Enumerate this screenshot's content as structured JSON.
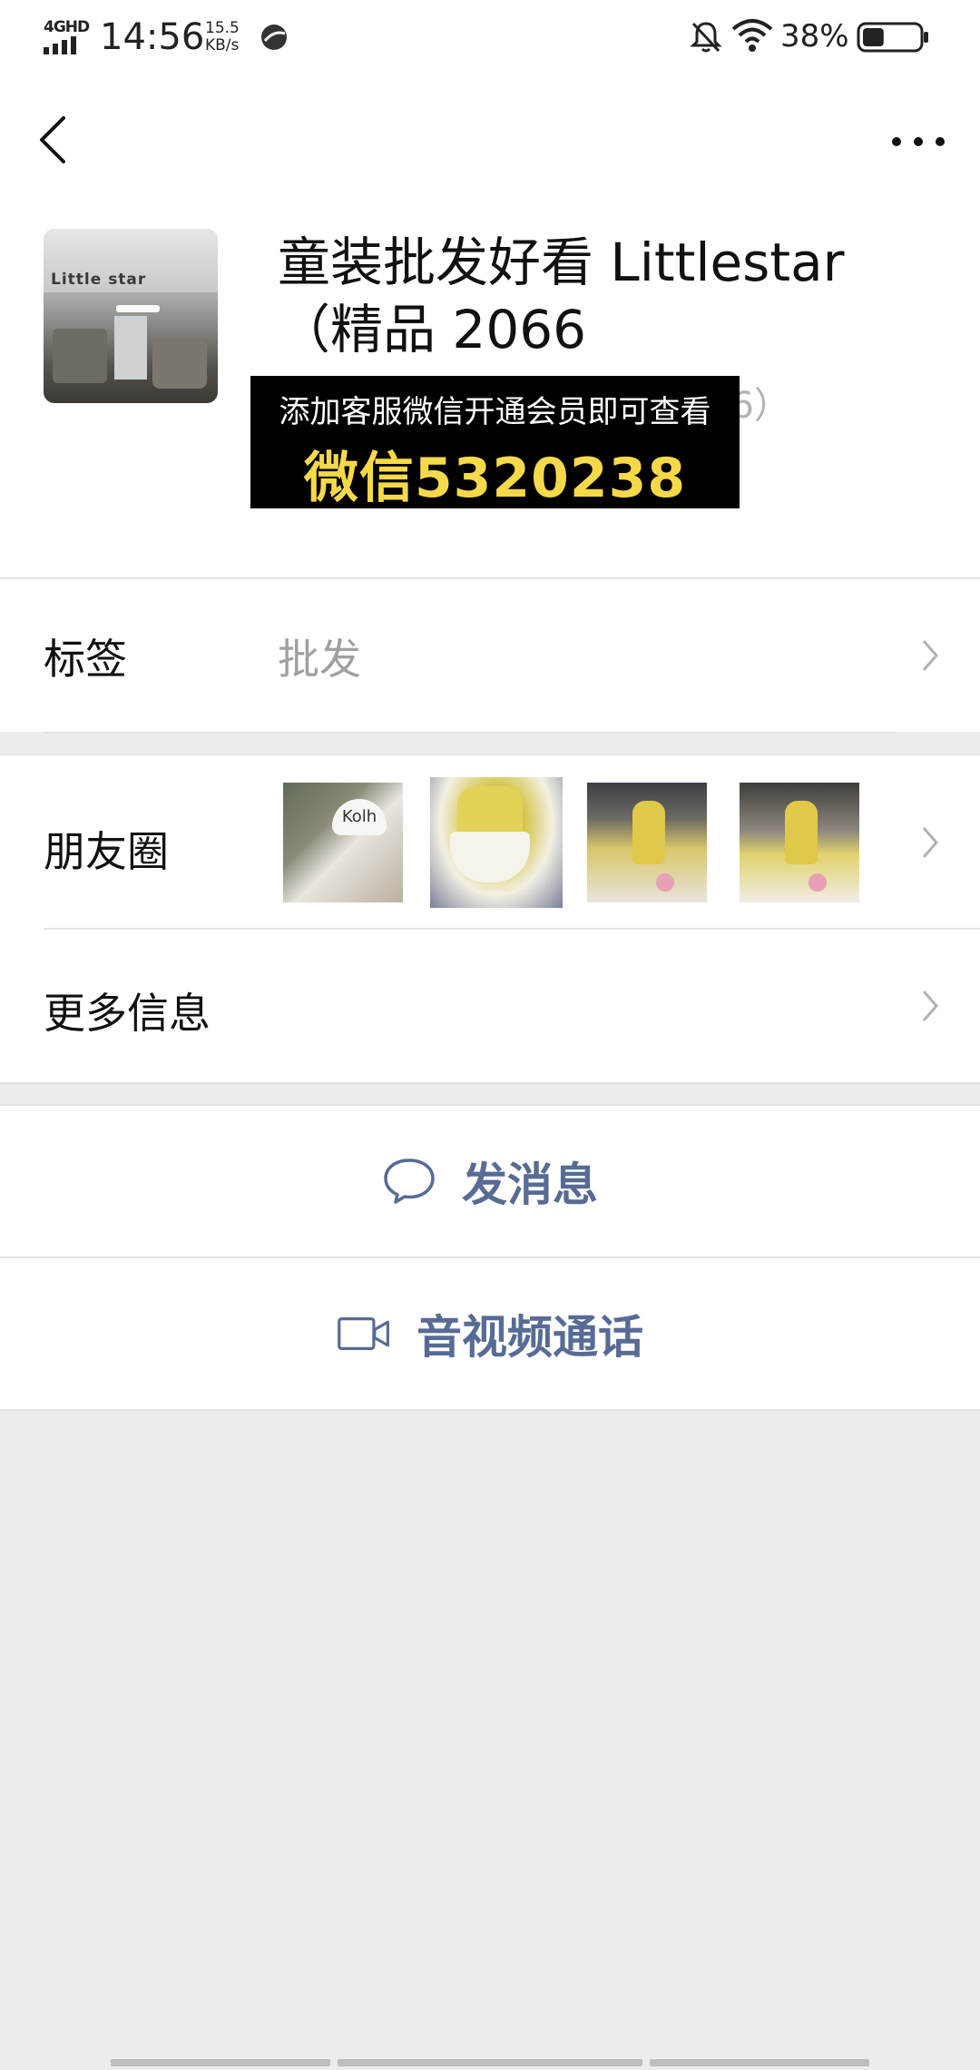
{
  "status_bar": {
    "network": "4GHD",
    "time": "14:56",
    "speed_value": "15.5",
    "speed_unit": "KB/s",
    "battery_percent": "38%",
    "battery_level": 0.38
  },
  "header": {
    "back_icon": "chevron-left-icon",
    "more_icon": "more-dots-icon"
  },
  "profile": {
    "avatar_sign_text": "Little star",
    "name": "童装批发好看 Littlestar（精品 2066",
    "id_fragment": "36）"
  },
  "promo": {
    "line1": "添加客服微信开通会员即可查看",
    "line2": "微信5320238",
    "text_color": "#f5d94a"
  },
  "rows": {
    "tags": {
      "label": "标签",
      "value": "批发"
    },
    "moments": {
      "label": "朋友圈",
      "thumb_text": "Kolh"
    },
    "more_info": {
      "label": "更多信息"
    }
  },
  "actions": {
    "message": {
      "label": "发消息",
      "icon": "chat-bubble-icon"
    },
    "call": {
      "label": "音视频通话",
      "icon": "video-camera-icon"
    }
  },
  "colors": {
    "link_blue": "#576b95",
    "background": "#ededed",
    "muted_text": "#a0a0a0"
  }
}
